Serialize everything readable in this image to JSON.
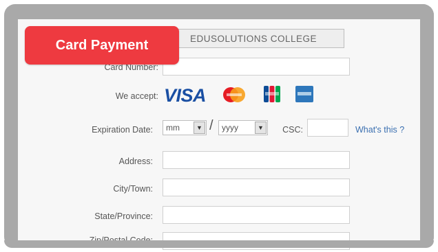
{
  "badge": {
    "title": "Card Payment"
  },
  "form": {
    "merchant_value": "EDUSOLUTIONS COLLEGE",
    "card_number_label": "Card Number:",
    "we_accept_label": "We accept:",
    "cards": [
      {
        "name": "VISA",
        "icon": "visa-icon"
      },
      {
        "name": "MasterCard",
        "icon": "mastercard-icon"
      },
      {
        "name": "JCB",
        "icon": "jcb-icon"
      },
      {
        "name": "American Express",
        "icon": "amex-icon"
      }
    ],
    "expiration_label": "Expiration Date:",
    "month_value": "mm",
    "year_value": "yyyy",
    "slash": "/",
    "csc_label": "CSC:",
    "whats_this": "What's this ?",
    "address_label": "Address:",
    "city_label": "City/Town:",
    "state_label": "State/Province:",
    "cut_label": "Zip/Postal Code:"
  },
  "colors": {
    "frame": "#a9a9a9",
    "badge": "#ee3a40",
    "visa": "#1a4fa3",
    "link": "#3a6fb0"
  }
}
